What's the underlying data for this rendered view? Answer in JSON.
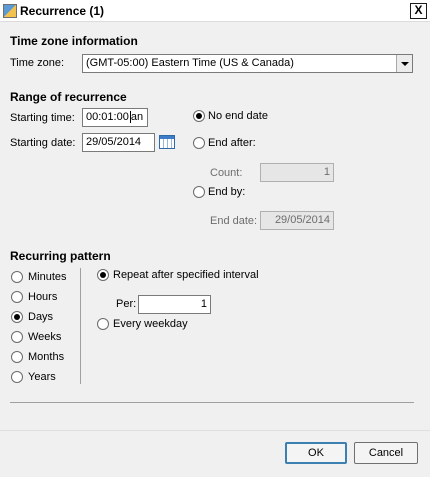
{
  "window": {
    "title": "Recurrence (1)",
    "close_glyph": "X"
  },
  "timezone": {
    "section_title": "Time zone information",
    "label": "Time zone:",
    "value": "(GMT-05:00) Eastern Time (US & Canada)"
  },
  "range": {
    "section_title": "Range of recurrence",
    "start_time_label": "Starting time:",
    "start_time_value": "00:01:00",
    "start_time_suffix": "an",
    "start_date_label": "Starting date:",
    "start_date_value": "29/05/2014",
    "no_end_label": "No end date",
    "end_after_label": "End after:",
    "count_label": "Count:",
    "count_value": "1",
    "end_by_label": "End by:",
    "end_date_label": "End date:",
    "end_date_value": "29/05/2014",
    "selected": "No end date"
  },
  "pattern": {
    "section_title": "Recurring pattern",
    "units": [
      "Minutes",
      "Hours",
      "Days",
      "Weeks",
      "Months",
      "Years"
    ],
    "selected_unit": "Days",
    "repeat_label": "Repeat after specified interval",
    "per_label": "Per:",
    "per_value": "1",
    "every_weekday_label": "Every weekday",
    "selected_mode": "Repeat after specified interval"
  },
  "footer": {
    "ok_label": "OK",
    "cancel_label": "Cancel"
  }
}
